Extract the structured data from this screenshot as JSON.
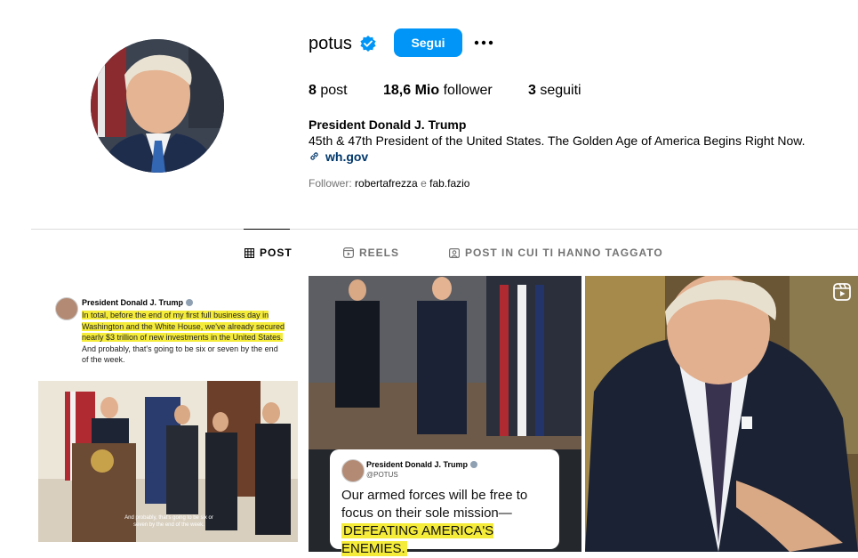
{
  "profile": {
    "username": "potus",
    "follow_label": "Segui",
    "stats": {
      "posts_count": "8",
      "posts_label": "post",
      "followers_count": "18,6 Mio",
      "followers_label": "follower",
      "following_count": "3",
      "following_label": "seguiti"
    },
    "full_name": "President Donald J. Trump",
    "bio": "45th & 47th President of the United States. The Golden Age of America Begins Right Now.",
    "link": "wh.gov",
    "followed_by_prefix": "Follower:",
    "followed_by_user1": "robertafrezza",
    "followed_by_sep": "e",
    "followed_by_user2": "fab.fazio"
  },
  "tabs": [
    {
      "label": "POST",
      "icon": "grid-icon",
      "active": true
    },
    {
      "label": "REELS",
      "icon": "reels-icon",
      "active": false
    },
    {
      "label": "POST IN CUI TI HANNO TAGGATO",
      "icon": "tagged-icon",
      "active": false
    }
  ],
  "posts": {
    "post1": {
      "author": "President Donald J. Trump",
      "text_hl1": "In total, before the end of my first full business day in Washington and the White House, we've already secured nearly $3 trillion of new investments in the United States.",
      "text_rest": " And probably, that's going to be six or seven by the end of the week.",
      "caption": "And probably, that's going to be six or seven by the end of the week."
    },
    "post2": {
      "author": "President Donald J. Trump",
      "handle": "@POTUS",
      "body_plain": "Our armed forces will be free to focus on their sole mission—",
      "body_hl": "DEFEATING AMERICA'S ENEMIES."
    },
    "post3": {
      "type": "reel",
      "icon": "reel-icon"
    }
  },
  "colors": {
    "accent": "#0095f6",
    "link": "#00376b",
    "muted": "#737373",
    "highlight": "#f5ec3a"
  }
}
